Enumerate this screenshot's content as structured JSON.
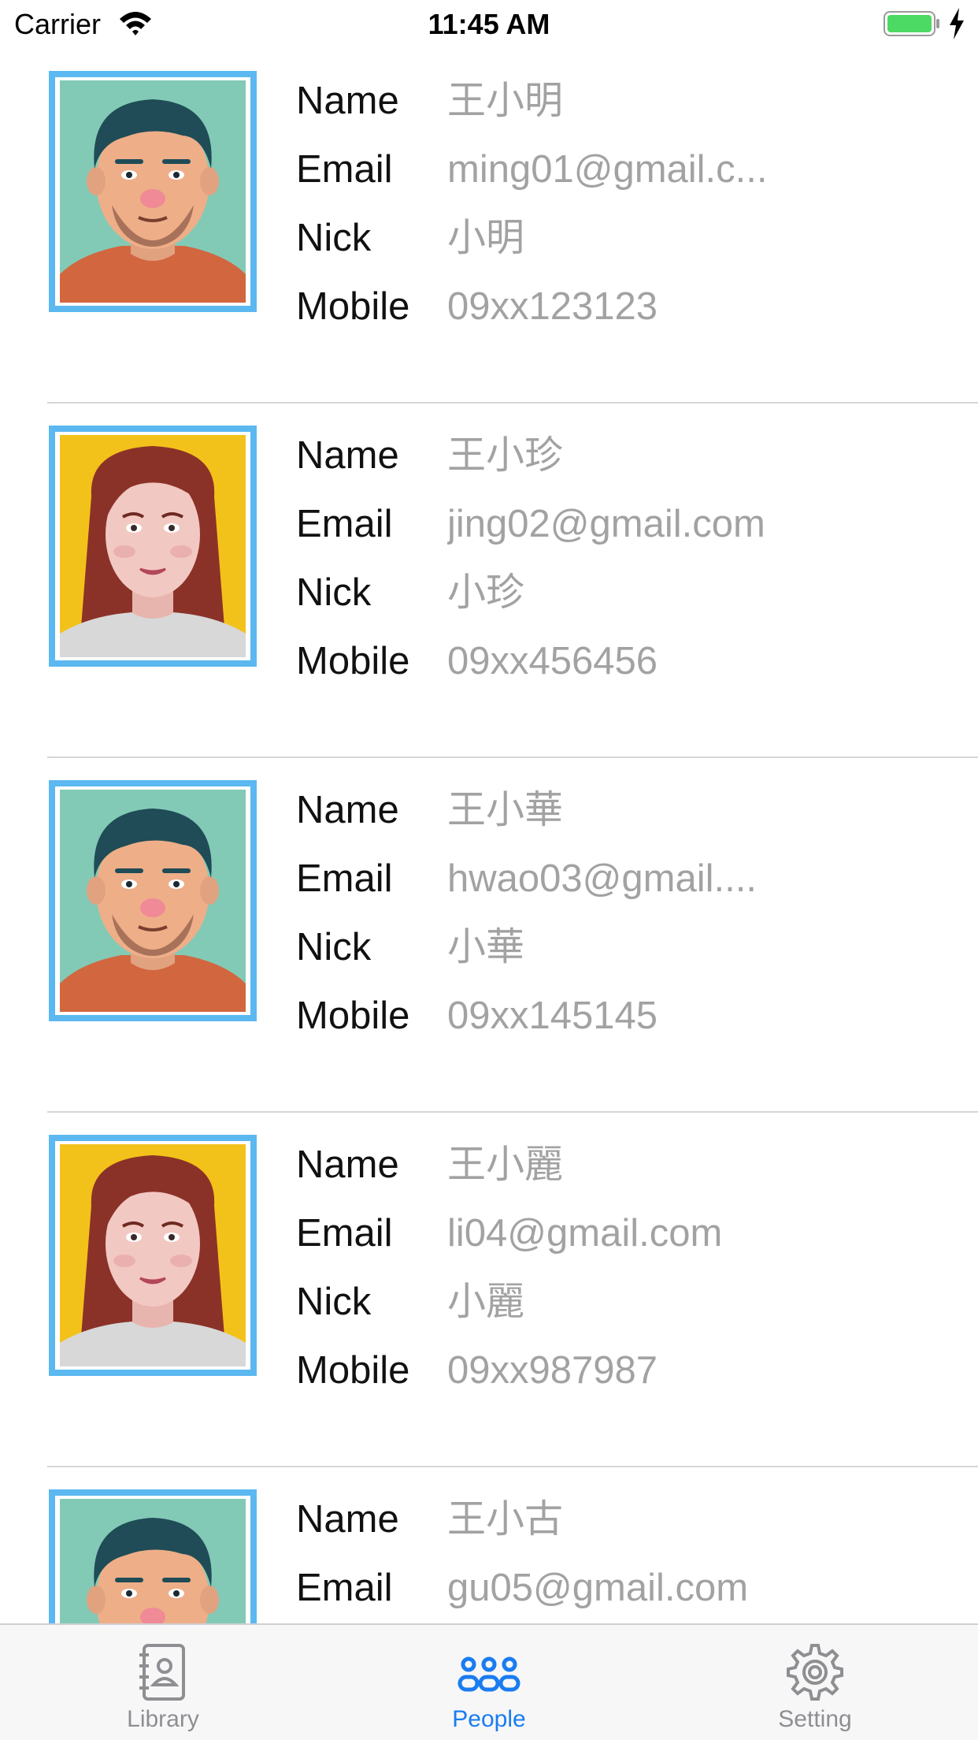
{
  "status_bar": {
    "carrier": "Carrier",
    "time": "11:45 AM",
    "battery_color": "#4cd964"
  },
  "field_labels": {
    "name": "Name",
    "email": "Email",
    "nick": "Nick",
    "mobile": "Mobile"
  },
  "people": [
    {
      "avatar": "man-avatar",
      "name": "王小明",
      "email": "ming01@gmail.c...",
      "nick": "小明",
      "mobile": "09xx123123"
    },
    {
      "avatar": "woman-avatar",
      "name": "王小珍",
      "email": "jing02@gmail.com",
      "nick": "小珍",
      "mobile": "09xx456456"
    },
    {
      "avatar": "man-avatar",
      "name": "王小華",
      "email": "hwao03@gmail....",
      "nick": "小華",
      "mobile": "09xx145145"
    },
    {
      "avatar": "woman-avatar",
      "name": "王小麗",
      "email": "li04@gmail.com",
      "nick": "小麗",
      "mobile": "09xx987987"
    },
    {
      "avatar": "man-avatar",
      "name": "王小古",
      "email": "gu05@gmail.com"
    }
  ],
  "tabs": [
    {
      "label": "Library",
      "icon": "contacts-book-icon",
      "active": false
    },
    {
      "label": "People",
      "icon": "people-icon",
      "active": true
    },
    {
      "label": "Setting",
      "icon": "gear-icon",
      "active": false
    }
  ],
  "colors": {
    "accent": "#1a7cf0",
    "avatar_frame": "#5bb8f0",
    "value_text": "#a2a2a2"
  }
}
